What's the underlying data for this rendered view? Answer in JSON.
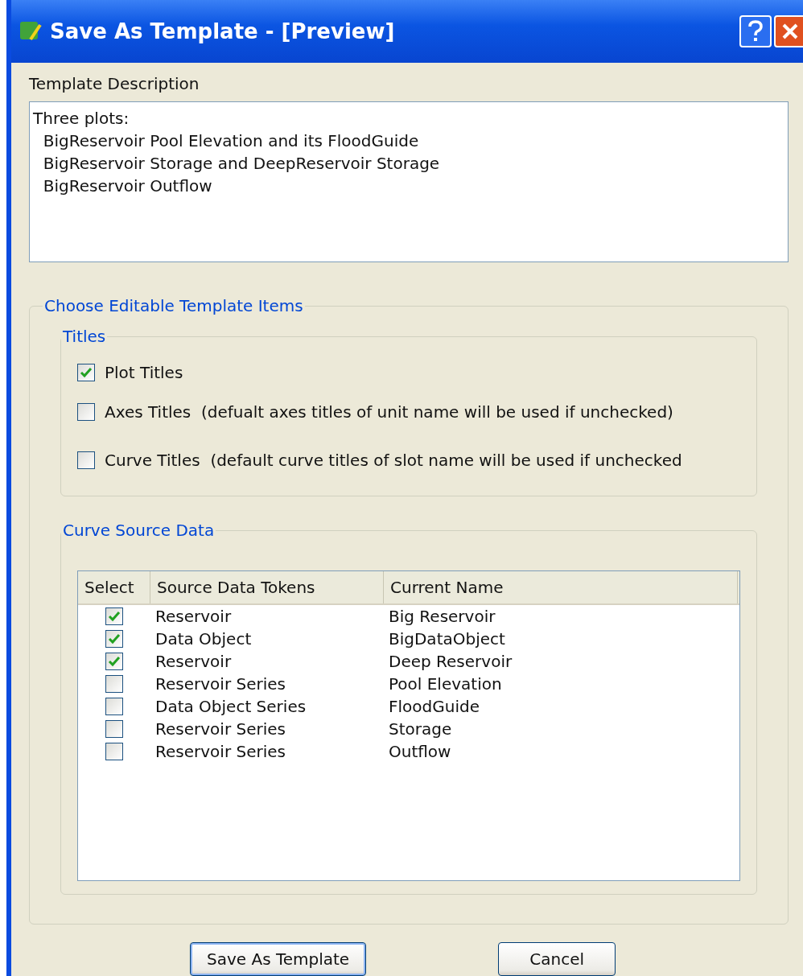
{
  "window": {
    "title": "Save As Template - [Preview]"
  },
  "description": {
    "label": "Template Description",
    "value": "Three plots:\n  BigReservoir Pool Elevation and its FloodGuide\n  BigReservoir Storage and DeepReservoir Storage\n  BigReservoir Outflow"
  },
  "editable_items": {
    "title": "Choose Editable Template Items",
    "titles": {
      "title": "Titles",
      "options": [
        {
          "label": "Plot Titles",
          "checked": true
        },
        {
          "label": "Axes Titles",
          "note": "(defualt axes titles of unit name will be used if unchecked)",
          "checked": false
        },
        {
          "label": "Curve Titles",
          "note": "(default curve titles of slot name will be used if unchecked",
          "checked": false
        }
      ]
    },
    "curve_source": {
      "title": "Curve Source Data",
      "columns": [
        "Select",
        "Source Data Tokens",
        "Current Name"
      ],
      "rows": [
        {
          "token": "Reservoir",
          "name": "Big Reservoir",
          "checked": true
        },
        {
          "token": "Data Object",
          "name": "BigDataObject",
          "checked": true
        },
        {
          "token": "Reservoir",
          "name": "Deep Reservoir",
          "checked": true
        },
        {
          "token": "Reservoir Series",
          "name": "Pool Elevation",
          "checked": false
        },
        {
          "token": "Data Object Series",
          "name": "FloodGuide",
          "checked": false
        },
        {
          "token": "Reservoir Series",
          "name": "Storage",
          "checked": false
        },
        {
          "token": "Reservoir Series",
          "name": "Outflow",
          "checked": false
        }
      ]
    }
  },
  "buttons": [
    {
      "label": "Save As Template",
      "default": true
    },
    {
      "label": "Cancel",
      "default": false
    }
  ]
}
